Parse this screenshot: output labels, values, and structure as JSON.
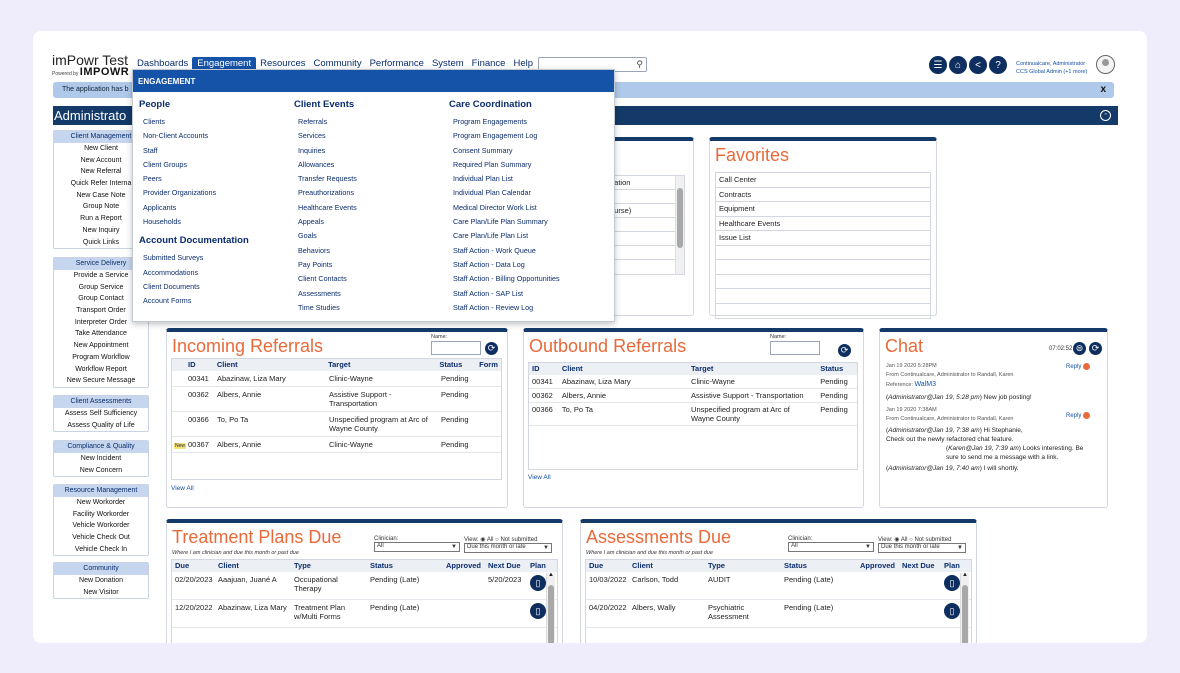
{
  "app": {
    "logo_title": "imPowr Test",
    "logo_powered": "Powered by",
    "logo_brand": "IMPOWR"
  },
  "nav": [
    "Dashboards",
    "Engagement",
    "Resources",
    "Community",
    "Performance",
    "System",
    "Finance",
    "Help"
  ],
  "search": {
    "placeholder": ""
  },
  "user": {
    "name": "Continualcare, Administrator",
    "org": "CCS Global Admin (+1 more)"
  },
  "banner": {
    "text": "The application has b",
    "close": "x"
  },
  "page_title": "Administrato",
  "sidebar": [
    {
      "header": "Client Management",
      "items": [
        "New Client",
        "New Account",
        "New Referral",
        "Quick Refer Interna",
        "New Case Note",
        "Group Note",
        "Run a Report",
        "New Inquiry",
        "Quick Links"
      ]
    },
    {
      "header": "Service Delivery",
      "items": [
        "Provide a Service",
        "Group Service",
        "Group Contact",
        "Transport Order",
        "Interpreter Order",
        "Take Attendance",
        "New Appointment",
        "Program Workflow",
        "Workflow Report",
        "New Secure Message"
      ]
    },
    {
      "header": "Client Assessments",
      "items": [
        "Assess Self Sufficiency",
        "Assess Quality of Life"
      ]
    },
    {
      "header": "Compliance & Quality",
      "items": [
        "New Incident",
        "New Concern"
      ]
    },
    {
      "header": "Resource Management",
      "items": [
        "New Workorder",
        "Facility Workorder",
        "Vehicle Workorder",
        "Vehicle Check Out",
        "Vehicle Check In"
      ]
    },
    {
      "header": "Community",
      "items": [
        "New Donation",
        "New Visitor"
      ]
    }
  ],
  "dropdown": {
    "header": "ENGAGEMENT",
    "people": {
      "title": "People",
      "items": [
        "Clients",
        "Non-Client Accounts",
        "Staff",
        "Client Groups",
        "Peers",
        "Provider Organizations",
        "Applicants",
        "Households"
      ]
    },
    "account_docs": {
      "title": "Account Documentation",
      "items": [
        "Submitted Surveys",
        "Accommodations",
        "Client Documents",
        "Account Forms"
      ]
    },
    "client_events": {
      "title": "Client Events",
      "items": [
        "Referrals",
        "Services",
        "Inquiries",
        "Allowances",
        "Transfer Requests",
        "Preauthorizations",
        "Healthcare Events",
        "Appeals",
        "Goals",
        "Behaviors",
        "Pay Points",
        "Client Contacts",
        "Assessments",
        "Time Studies"
      ]
    },
    "care_coord": {
      "title": "Care Coordination",
      "items": [
        "Program Engagements",
        "Program Engagement Log",
        "Consent Summary",
        "Required Plan Summary",
        "Individual Plan List",
        "Individual Plan Calendar",
        "Medical Director Work List",
        "Care Plan/Life Plan Summary",
        "Care Plan/Life Plan List",
        "Staff Action - Work Queue",
        "Staff Action - Data Log",
        "Staff Action - Billing Opportunities",
        "Staff Action - SAP List",
        "Staff Action - Review Log"
      ]
    }
  },
  "partial_panel": {
    "rows": [
      "dation",
      "ourse)"
    ]
  },
  "favorites": {
    "title": "Favorites",
    "items": [
      "Call Center",
      "Contracts",
      "Equipment",
      "Healthcare Events",
      "Issue List"
    ]
  },
  "incoming": {
    "title": "Incoming Referrals",
    "name_label": "Name:",
    "view_all": "View All",
    "headers": [
      "ID",
      "Client",
      "Target",
      "Status",
      "Form"
    ],
    "rows": [
      {
        "id": "00341",
        "client": "Abazinaw, Liza Mary",
        "target": "Clinic-Wayne",
        "status": "Pending",
        "new": ""
      },
      {
        "id": "00362",
        "client": "Albers, Annie",
        "target": "Assistive Support - Transportation",
        "status": "Pending",
        "new": ""
      },
      {
        "id": "00366",
        "client": "To, Po Ta",
        "target": "Unspecified program at Arc of Wayne County",
        "status": "Pending",
        "new": ""
      },
      {
        "id": "00367",
        "client": "Albers, Annie",
        "target": "Clinic-Wayne",
        "status": "Pending",
        "new": "New"
      }
    ]
  },
  "outbound": {
    "title": "Outbound Referrals",
    "name_label": "Name:",
    "view_all": "View All",
    "headers": [
      "ID",
      "Client",
      "Target",
      "Status"
    ],
    "rows": [
      {
        "id": "00341",
        "client": "Abazinaw, Liza Mary",
        "target": "Clinic-Wayne",
        "status": "Pending"
      },
      {
        "id": "00362",
        "client": "Albers, Annie",
        "target": "Assistive Support - Transportation",
        "status": "Pending"
      },
      {
        "id": "00366",
        "client": "To, Po Ta",
        "target": "Unspecified program at Arc of Wayne County",
        "status": "Pending"
      }
    ]
  },
  "chat": {
    "title": "Chat",
    "time": "07:02:52",
    "reply": "Reply",
    "m1_date": "Jan 19 2020 5:28PM",
    "m1_from": "From Continualcare, Administrator to Randall, Karen",
    "m1_ref_label": "Reference:",
    "m1_ref": "WalM3",
    "m1_author": "Administrator@Jan 19, 5:28 pm",
    "m1_text": "New job posting!",
    "m2_date": "Jan 19 2020 7:38AM",
    "m2_from": "From Continualcare, Administrator to Randall, Karen",
    "m2_author": "Administrator@Jan 19, 7:38 am",
    "m2_text": "Hi Stephanie,",
    "m2_text2": "Check out the newly refactored chat feature.",
    "m3_author": "Karen@Jan 19, 7:39 am",
    "m3_text": "Looks interesting. Be sure to send me a message with a link.",
    "m4_author": "Administrator@Jan 19, 7:40 am",
    "m4_text": "I will shortly."
  },
  "treatment": {
    "title": "Treatment Plans Due",
    "subtitle": "Where I am clinician and due this month or past due",
    "clinician_label": "Clinician:",
    "clinician_value": "All",
    "view_label": "View:",
    "view_all": "All",
    "view_not": "Not submitted",
    "due_value": "Due this month or late",
    "headers": [
      "Due",
      "Client",
      "Type",
      "Status",
      "Approved",
      "Next Due",
      "Plan"
    ],
    "rows": [
      {
        "due": "02/20/2023",
        "client": "Aaajuan, Juané A",
        "type": "Occupational Therapy",
        "status": "Pending (Late)",
        "approved": "",
        "next": "5/20/2023"
      },
      {
        "due": "12/20/2022",
        "client": "Abazinaw, Liza Mary",
        "type": "Treatment Plan w/Multi Forms",
        "status": "Pending (Late)",
        "approved": "",
        "next": ""
      }
    ]
  },
  "assessments": {
    "title": "Assessments Due",
    "subtitle": "Where I am clinician and due this month or past due",
    "clinician_label": "Clinician:",
    "clinician_value": "All",
    "view_label": "View:",
    "view_all": "All",
    "view_not": "Not submitted",
    "due_value": "Due this month or late",
    "headers": [
      "Due",
      "Client",
      "Type",
      "Status",
      "Approved",
      "Next Due",
      "Plan"
    ],
    "rows": [
      {
        "due": "10/03/2022",
        "client": "Carlson, Todd",
        "type": "AUDIT",
        "status": "Pending (Late)",
        "approved": "",
        "next": ""
      },
      {
        "due": "04/20/2022",
        "client": "Albers, Wally",
        "type": "Psychiatric Assessment",
        "status": "Pending (Late)",
        "approved": "",
        "next": ""
      }
    ]
  }
}
